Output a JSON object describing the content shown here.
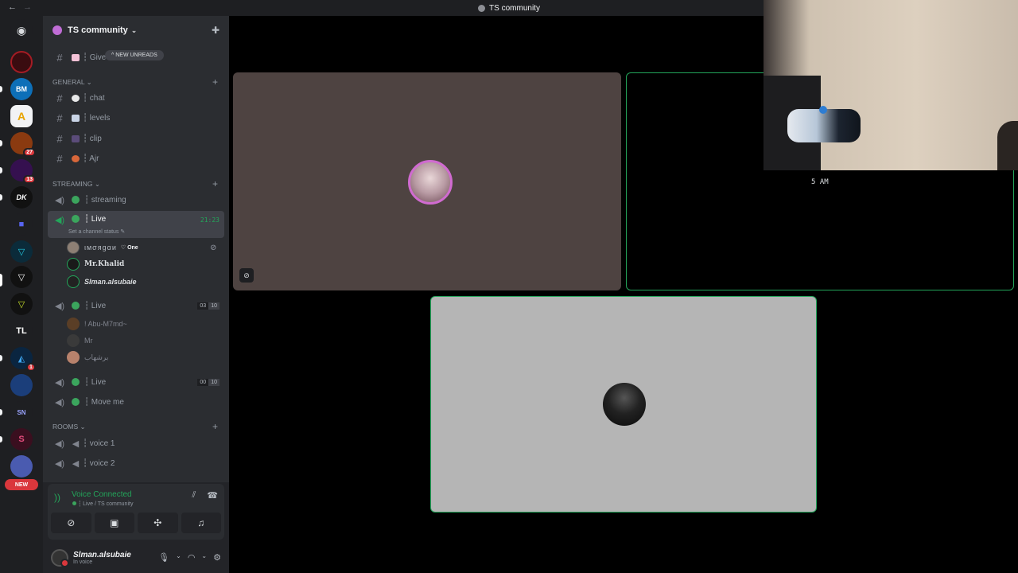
{
  "window": {
    "title": "TS community",
    "back": "←",
    "forward": "→"
  },
  "servers": [
    {
      "name": "discord-home",
      "label": ""
    },
    {
      "name": "server-red",
      "label": ""
    },
    {
      "name": "server-bm",
      "label": "BM"
    },
    {
      "name": "server-a",
      "label": "A"
    },
    {
      "name": "server-orange",
      "label": "",
      "badge": "27"
    },
    {
      "name": "server-purple",
      "label": "",
      "badge": "13"
    },
    {
      "name": "server-dk",
      "label": "DK"
    },
    {
      "name": "folder",
      "label": ""
    },
    {
      "name": "server-v1",
      "label": ""
    },
    {
      "name": "server-v2",
      "label": ""
    },
    {
      "name": "server-v3",
      "label": ""
    },
    {
      "name": "server-tl",
      "label": "TL"
    },
    {
      "name": "server-blue",
      "label": "",
      "badge": "1"
    },
    {
      "name": "server-sky",
      "label": ""
    },
    {
      "name": "server-sn",
      "label": "SN"
    },
    {
      "name": "server-pink",
      "label": ""
    },
    {
      "name": "server-new",
      "label": ""
    }
  ],
  "new_tag": "NEW",
  "guild": {
    "name": "TS community",
    "chevron": "⌄"
  },
  "unreads_pill": "^ NEW UNREADS",
  "channels_top": [
    {
      "label": "┆ Give"
    }
  ],
  "categories": {
    "general": "GENERAL ⌄",
    "streaming": "STREAMING ⌄",
    "rooms": "ROOMS ⌄"
  },
  "general_channels": [
    {
      "label": "┆ chat"
    },
    {
      "label": "┆ levels"
    },
    {
      "label": "┆ clip"
    },
    {
      "label": "┆ Ajr"
    }
  ],
  "streaming": {
    "streaming_channel": "┆ streaming",
    "live_active": "┆ Live",
    "live_timer": "21:23",
    "set_status": "Set a channel status ✎",
    "users_live": [
      {
        "name": "ιмσяgαи",
        "tag": "♡ One"
      },
      {
        "name": "Mr.Khalid"
      },
      {
        "name": "Slman.alsubaie"
      }
    ],
    "live2": "┆ Live",
    "live2_counts": [
      "03",
      "10"
    ],
    "users_live2": [
      {
        "name": "! Abu-M7md~"
      },
      {
        "name": "Mr"
      },
      {
        "name": "برشهاب"
      }
    ],
    "live3": "┆ Live",
    "live3_counts": [
      "00",
      "10"
    ],
    "move_me": "┆ Move me"
  },
  "rooms": [
    {
      "label": "┆ voice 1"
    },
    {
      "label": "┆ voice 2"
    }
  ],
  "voice_panel": {
    "status": "Voice Connected",
    "location": "┆ Live / TS community"
  },
  "me": {
    "name": "Slman.alsubaie",
    "status": "In voice"
  },
  "stage": {
    "time_text": "5 AM"
  },
  "colors": {
    "green": "#23a55a",
    "red": "#da373c",
    "sidebar": "#2b2d31",
    "rail": "#1e1f22"
  }
}
